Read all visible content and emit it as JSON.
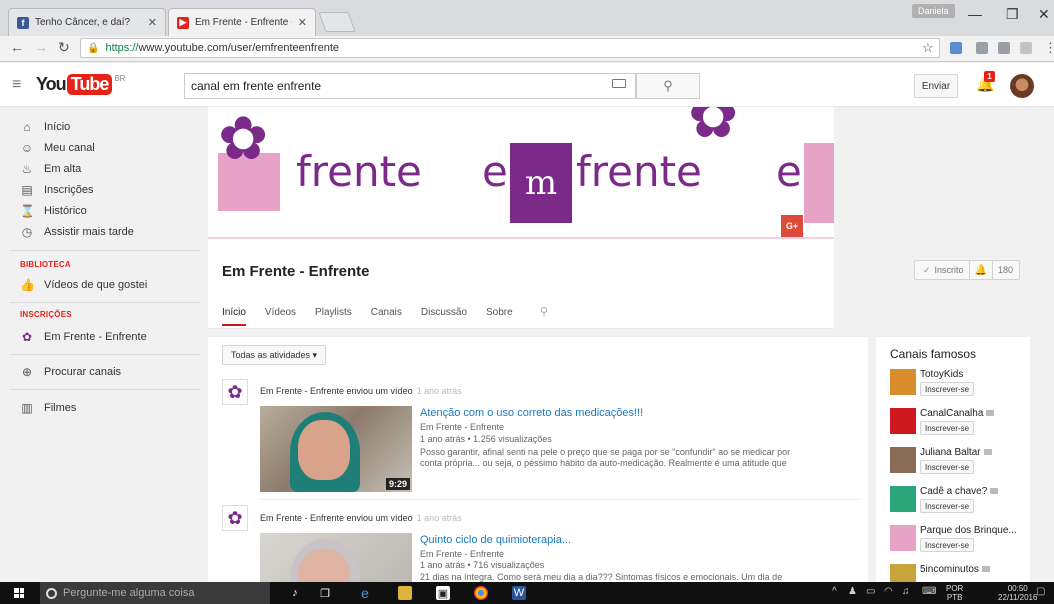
{
  "browser": {
    "tabs": [
      {
        "title": "Tenho Câncer, e daí?",
        "icon": "facebook-icon",
        "color": "#3b5998"
      },
      {
        "title": "Em Frente - Enfrente - Yo",
        "icon": "youtube-icon",
        "color": "#e62117"
      }
    ],
    "profile_name": "Daniela",
    "url_scheme": "https://",
    "url_rest": "www.youtube.com/user/emfrenteenfrente"
  },
  "youtube": {
    "logo_you": "You",
    "logo_tube": "Tube",
    "logo_region": "BR",
    "search_value": "canal em frente enfrente",
    "upload_label": "Enviar",
    "notification_count": "1"
  },
  "sidebar": {
    "items": [
      {
        "label": "Início",
        "icon": "home-icon"
      },
      {
        "label": "Meu canal",
        "icon": "user-icon"
      },
      {
        "label": "Em alta",
        "icon": "flame-icon"
      },
      {
        "label": "Inscrições",
        "icon": "subscriptions-icon"
      },
      {
        "label": "Histórico",
        "icon": "hourglass-icon"
      },
      {
        "label": "Assistir mais tarde",
        "icon": "clock-icon"
      }
    ],
    "library_title": "BIBLIOTECA",
    "library_items": [
      {
        "label": "Vídeos de que gostei",
        "icon": "thumbs-up-icon"
      }
    ],
    "subscriptions_title": "INSCRIÇÕES",
    "subscription_items": [
      {
        "label": "Em Frente - Enfrente",
        "icon": "flower-icon"
      }
    ],
    "browse_channels": "Procurar canais",
    "movies": "Filmes"
  },
  "channel": {
    "banner_words": [
      "frente",
      "frente",
      "frente"
    ],
    "banner_mark": "m",
    "gplus": "G+",
    "title": "Em Frente - Enfrente",
    "subscribed_label": "Inscrito",
    "subscriber_count": "180",
    "tabs": [
      "Início",
      "Vídeos",
      "Playlists",
      "Canais",
      "Discussão",
      "Sobre"
    ],
    "active_tab": "Início"
  },
  "feed": {
    "filter_label": "Todas as atividades ▾",
    "items": [
      {
        "actor": "Em Frente - Enfrente enviou um vídeo",
        "time": "1 ano atrás",
        "title": "Atenção com o uso correto das medicações!!!",
        "channel": "Em Frente - Enfrente",
        "meta": "1 ano atrás • 1.256 visualizações",
        "desc": "Posso garantir, afinal senti na pele o preço que se paga por se \"confundir\" ao se medicar por conta própria... ou seja, o péssimo hábito da auto-medicação. Realmente é uma atitude que",
        "duration": "9:29"
      },
      {
        "actor": "Em Frente - Enfrente enviou um vídeo",
        "time": "1 ano atrás",
        "title": "Quinto ciclo de quimioterapia...",
        "channel": "Em Frente - Enfrente",
        "meta": "1 ano atrás • 716 visualizações",
        "desc": "21 dias na íntegra. Como será meu dia a dia??? Sintomas físicos e emocionais. Um dia de",
        "duration": ""
      }
    ]
  },
  "rail": {
    "title": "Canais famosos",
    "subscribe_label": "Inscrever-se",
    "channels": [
      {
        "name": "TotoyKids",
        "color": "#d98c2b",
        "verified": false
      },
      {
        "name": "CanalCanalha",
        "color": "#cc181e",
        "verified": true
      },
      {
        "name": "Juliana Baltar",
        "color": "#8a6b55",
        "verified": true
      },
      {
        "name": "Cadê a chave?",
        "color": "#2aa67a",
        "verified": true
      },
      {
        "name": "Parque dos Brinque...",
        "color": "#e7a3c6",
        "verified": false
      },
      {
        "name": "5incominutos",
        "color": "#c8a23a",
        "verified": true
      }
    ]
  },
  "taskbar": {
    "search_placeholder": "Pergunte-me alguma coisa",
    "lang_top": "POR",
    "lang_bottom": "PTB",
    "time": "00:50",
    "date": "22/11/2016"
  }
}
